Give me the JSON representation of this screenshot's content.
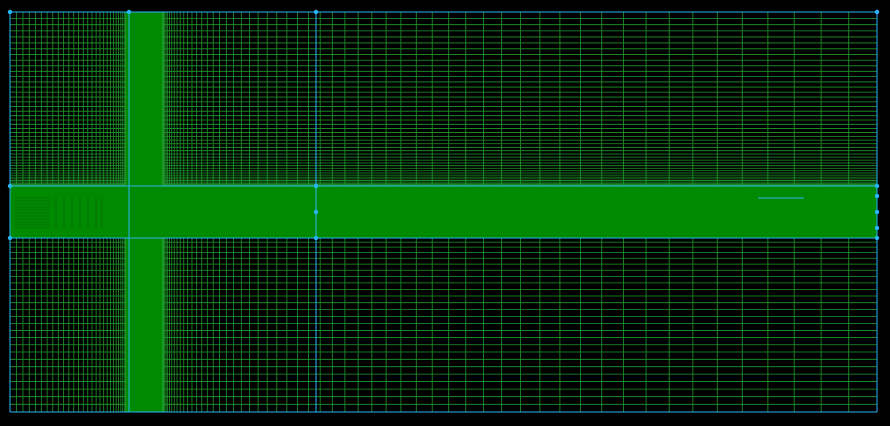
{
  "viewer": {
    "background_color": "#000000"
  },
  "mesh": {
    "line_color": "#1f9a2a",
    "fill_color": "#008a00",
    "block_edge_color": "#29b6f6",
    "vertex_color": "#29b6f6",
    "blocks": [
      {
        "id": "upper-left"
      },
      {
        "id": "upper-mid"
      },
      {
        "id": "upper-right"
      },
      {
        "id": "center-band"
      },
      {
        "id": "lower-left"
      },
      {
        "id": "lower-mid"
      },
      {
        "id": "lower-right"
      }
    ]
  }
}
